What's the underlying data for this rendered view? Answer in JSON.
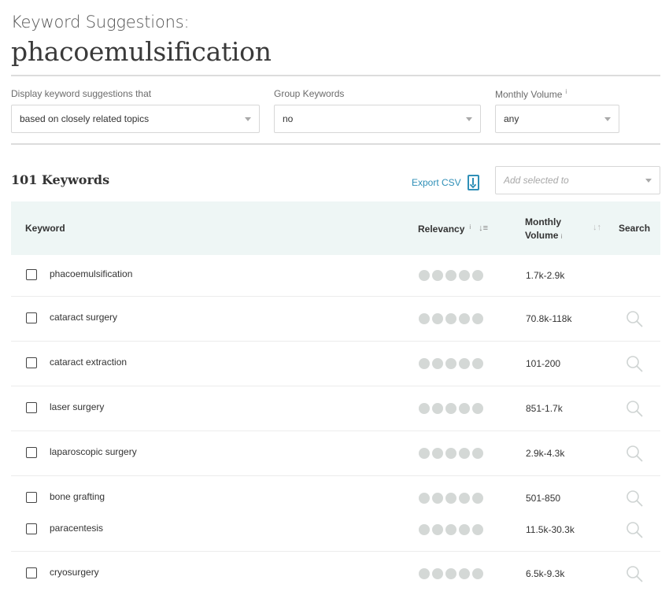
{
  "header": {
    "label": "Keyword Suggestions:",
    "query": "phacoemulsification"
  },
  "filters": {
    "display": {
      "label": "Display keyword suggestions that",
      "value": "based on closely related topics"
    },
    "group": {
      "label": "Group Keywords",
      "value": "no"
    },
    "volume": {
      "label": "Monthly Volume",
      "info": "i",
      "value": "any"
    }
  },
  "results": {
    "count_label": "101 Keywords",
    "export_label": "Export CSV",
    "add_selected_placeholder": "Add selected to"
  },
  "table": {
    "headers": {
      "keyword": "Keyword",
      "relevancy": "Relevancy",
      "relevancy_info": "i",
      "volume_line1": "Monthly",
      "volume_line2": "Volume",
      "volume_info": "i",
      "search": "Search"
    },
    "rows": [
      {
        "keyword": "phacoemulsification",
        "volume": "1.7k-2.9k",
        "relevancy_dots": 5,
        "has_search": false
      },
      {
        "keyword": "cataract surgery",
        "volume": "70.8k-118k",
        "relevancy_dots": 5,
        "has_search": true
      },
      {
        "keyword": "cataract extraction",
        "volume": "101-200",
        "relevancy_dots": 5,
        "has_search": true
      },
      {
        "keyword": "laser surgery",
        "volume": "851-1.7k",
        "relevancy_dots": 5,
        "has_search": true
      },
      {
        "keyword": "laparoscopic surgery",
        "volume": "2.9k-4.3k",
        "relevancy_dots": 5,
        "has_search": true
      },
      {
        "keyword": "bone grafting",
        "volume": "501-850",
        "relevancy_dots": 5,
        "has_search": true
      },
      {
        "keyword": "paracentesis",
        "volume": "11.5k-30.3k",
        "relevancy_dots": 5,
        "has_search": true
      },
      {
        "keyword": "cryosurgery",
        "volume": "6.5k-9.3k",
        "relevancy_dots": 5,
        "has_search": true
      }
    ]
  },
  "colors": {
    "accent": "#2f8fb7",
    "header_bg": "#eef6f5",
    "dot": "#d4d8d6"
  }
}
